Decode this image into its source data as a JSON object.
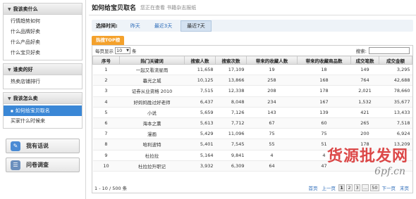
{
  "sidebar": {
    "groups": [
      {
        "title": "我该卖什么",
        "items": [
          {
            "label": "行情趋势如何"
          },
          {
            "label": "什么品牌好卖"
          },
          {
            "label": "什么产品好卖"
          },
          {
            "label": "什么宝贝好卖"
          }
        ]
      },
      {
        "title": "谁卖的好",
        "items": [
          {
            "label": "热卖店铺排行"
          }
        ]
      },
      {
        "title": "我该怎么卖",
        "items": [
          {
            "label": "如何给宝贝取名"
          },
          {
            "label": "买家什么时候来"
          }
        ]
      }
    ],
    "buttons": {
      "chat": "我有话说",
      "survey": "问卷调查"
    }
  },
  "header": {
    "title": "如何给宝贝取名",
    "subtitle": "您正在查看 书籍杂志报纸"
  },
  "time_filter": {
    "label": "选择时间:",
    "options": [
      "昨天",
      "最近3天",
      "最近7天"
    ],
    "selected": "最近7天"
  },
  "tab": {
    "label": "热搜TOP榜"
  },
  "toolbar": {
    "per_page_prefix": "每页显示",
    "per_page_value": "10",
    "per_page_suffix": "条",
    "search_label": "搜索:"
  },
  "table": {
    "columns": [
      "序号",
      "热门关键词",
      "搜索人数",
      "搜索次数",
      "带来的收藏人数",
      "带来的收藏商品数",
      "成交笔数",
      "成交金额"
    ],
    "rows": [
      [
        "1",
        "一起又看流星雨",
        "11,658",
        "17,109",
        "19",
        "18",
        "149",
        "3,295"
      ],
      [
        "2",
        "暮光之城",
        "10,125",
        "13,866",
        "258",
        "168",
        "764",
        "42,688"
      ],
      [
        "3",
        "证券从业资格 2010",
        "7,515",
        "12,338",
        "208",
        "178",
        "2,021",
        "78,660"
      ],
      [
        "4",
        "好妈妈胜过好老师",
        "6,437",
        "8,048",
        "234",
        "167",
        "1,532",
        "35,677"
      ],
      [
        "5",
        "小说",
        "5,659",
        "7,126",
        "143",
        "139",
        "421",
        "13,433"
      ],
      [
        "6",
        "海本之薰",
        "5,613",
        "7,712",
        "67",
        "60",
        "265",
        "7,518"
      ],
      [
        "7",
        "漫画",
        "5,429",
        "11,096",
        "75",
        "75",
        "200",
        "6,924"
      ],
      [
        "8",
        "哈利波特",
        "5,401",
        "7,545",
        "55",
        "51",
        "178",
        "13,209"
      ],
      [
        "9",
        "杜拉拉",
        "5,164",
        "9,841",
        "4",
        "4",
        "",
        ""
      ],
      [
        "10",
        "杜拉拉升职记",
        "3,932",
        "6,309",
        "64",
        "47",
        "",
        ""
      ]
    ]
  },
  "footer": {
    "info": "1 - 10 / 500 条"
  },
  "pager": {
    "first": "首页",
    "prev": "上一页",
    "pages": [
      "1",
      "2",
      "3",
      "...",
      "50"
    ],
    "current": "1",
    "next": "下一页",
    "last": "末页"
  },
  "watermark": {
    "cn": "货源批发网",
    "en": "6pf.cn"
  },
  "colors": {
    "accent": "#3a87d6",
    "tab": "#f4a12c",
    "link": "#2a6ab8",
    "watermark": "#d62828"
  }
}
